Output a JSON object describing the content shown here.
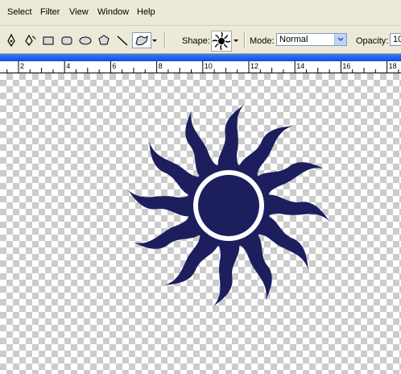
{
  "menu": {
    "items": [
      {
        "name": "menu-select",
        "label": "Select"
      },
      {
        "name": "menu-filter",
        "label": "Filter"
      },
      {
        "name": "menu-view",
        "label": "View"
      },
      {
        "name": "menu-window",
        "label": "Window"
      },
      {
        "name": "menu-help",
        "label": "Help"
      }
    ]
  },
  "options": {
    "shape_label": "Shape:",
    "shape_value": "sun-burst-shape",
    "mode_label": "Mode:",
    "mode_value": "Normal",
    "opacity_label": "Opacity:",
    "opacity_value": "10"
  },
  "ruler": {
    "ticks": [
      "2",
      "4",
      "6",
      "8",
      "10",
      "12",
      "14",
      "16",
      "18"
    ]
  },
  "colors": {
    "shape_fill": "#1c1e5e",
    "title_bar": "#0a50d8",
    "ui_face": "#ece9d8"
  }
}
